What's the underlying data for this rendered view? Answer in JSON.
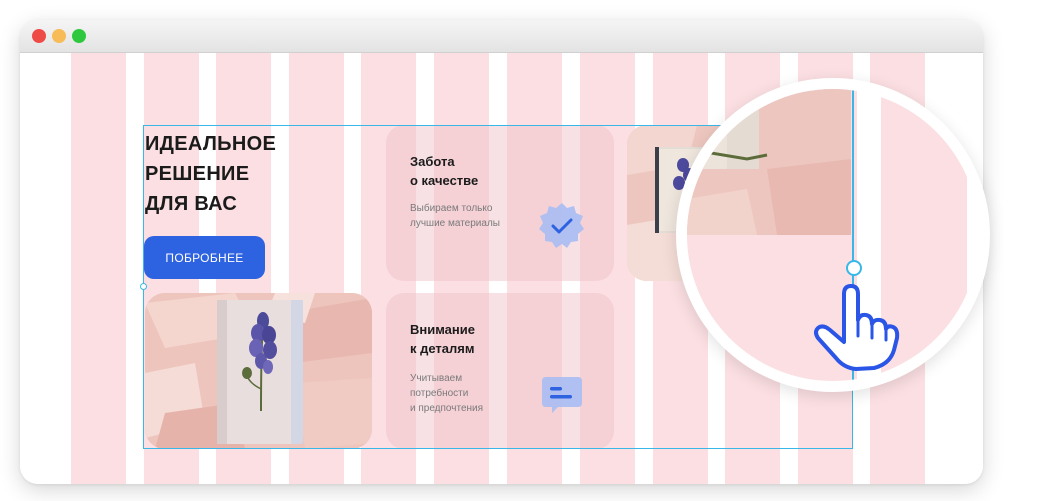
{
  "window": {
    "controls": [
      "close",
      "minimize",
      "maximize"
    ]
  },
  "hero": {
    "headline": [
      "ИДЕАЛЬНОЕ",
      "РЕШЕНИЕ",
      "ДЛЯ ВАС"
    ],
    "button_label": "ПОБРОБНЕЕ"
  },
  "cards": [
    {
      "title": [
        "Забота",
        "о качестве"
      ],
      "text": [
        "Выбираем только",
        "лучшие материалы"
      ],
      "icon": "check-badge-icon"
    },
    {
      "title": [
        "Внимание",
        "к деталям"
      ],
      "text": [
        "Учитываем",
        "потребности",
        "и предпочтения"
      ],
      "icon": "chat-bubble-icon"
    }
  ],
  "images": [
    "lupine-flower-on-book-photo",
    "lupine-flowers-on-open-book-photo"
  ],
  "colors": {
    "accent": "#2d62e0",
    "grid_column": "#fbdfe2",
    "guide": "#39b7e6",
    "cursor": "#2a55e6"
  }
}
